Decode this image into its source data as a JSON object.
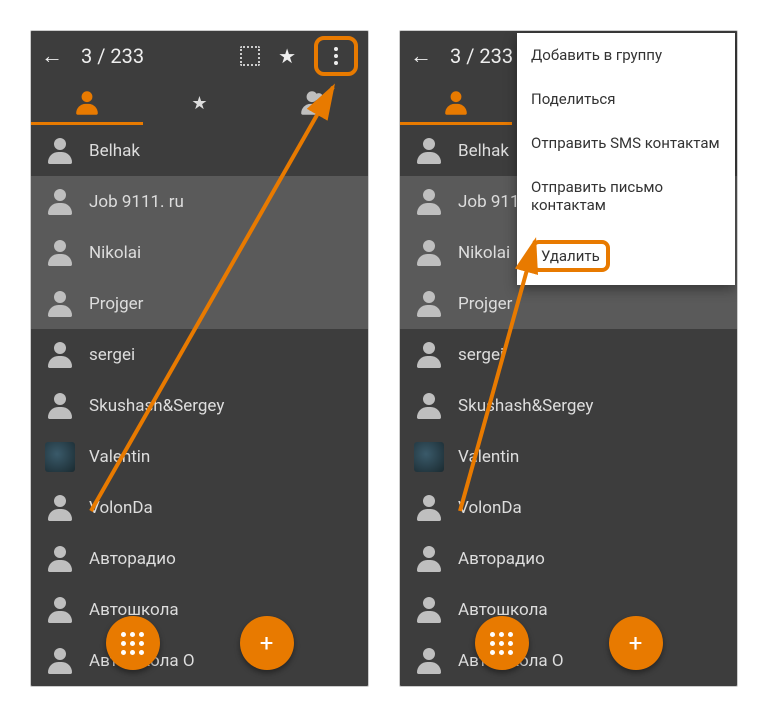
{
  "colors": {
    "accent": "#e87a00",
    "bg": "#3d3d3d",
    "row_selected": "#5a5a5a"
  },
  "header": {
    "title": "3 / 233"
  },
  "contacts": [
    {
      "name": "Belhak",
      "selected": false,
      "avatar": "glyph"
    },
    {
      "name": "Job 9111. ru",
      "selected": true,
      "avatar": "glyph"
    },
    {
      "name": "Nikolai",
      "selected": true,
      "avatar": "glyph"
    },
    {
      "name": "Projger",
      "selected": true,
      "avatar": "glyph"
    },
    {
      "name": "sergei",
      "selected": false,
      "avatar": "glyph"
    },
    {
      "name": "Skushash&Sergey",
      "selected": false,
      "avatar": "glyph"
    },
    {
      "name": "Valentin",
      "selected": false,
      "avatar": "image"
    },
    {
      "name": "VolonDa",
      "selected": false,
      "avatar": "glyph"
    },
    {
      "name": "Авторадио",
      "selected": false,
      "avatar": "glyph"
    },
    {
      "name": "Автошкола",
      "selected": false,
      "avatar": "glyph"
    },
    {
      "name": "Автошкола О",
      "selected": false,
      "avatar": "glyph"
    }
  ],
  "menu": {
    "items": [
      "Добавить в группу",
      "Поделиться",
      "Отправить SMS контактам",
      "Отправить письмо контактам",
      "Удалить"
    ],
    "highlighted_index": 4
  }
}
